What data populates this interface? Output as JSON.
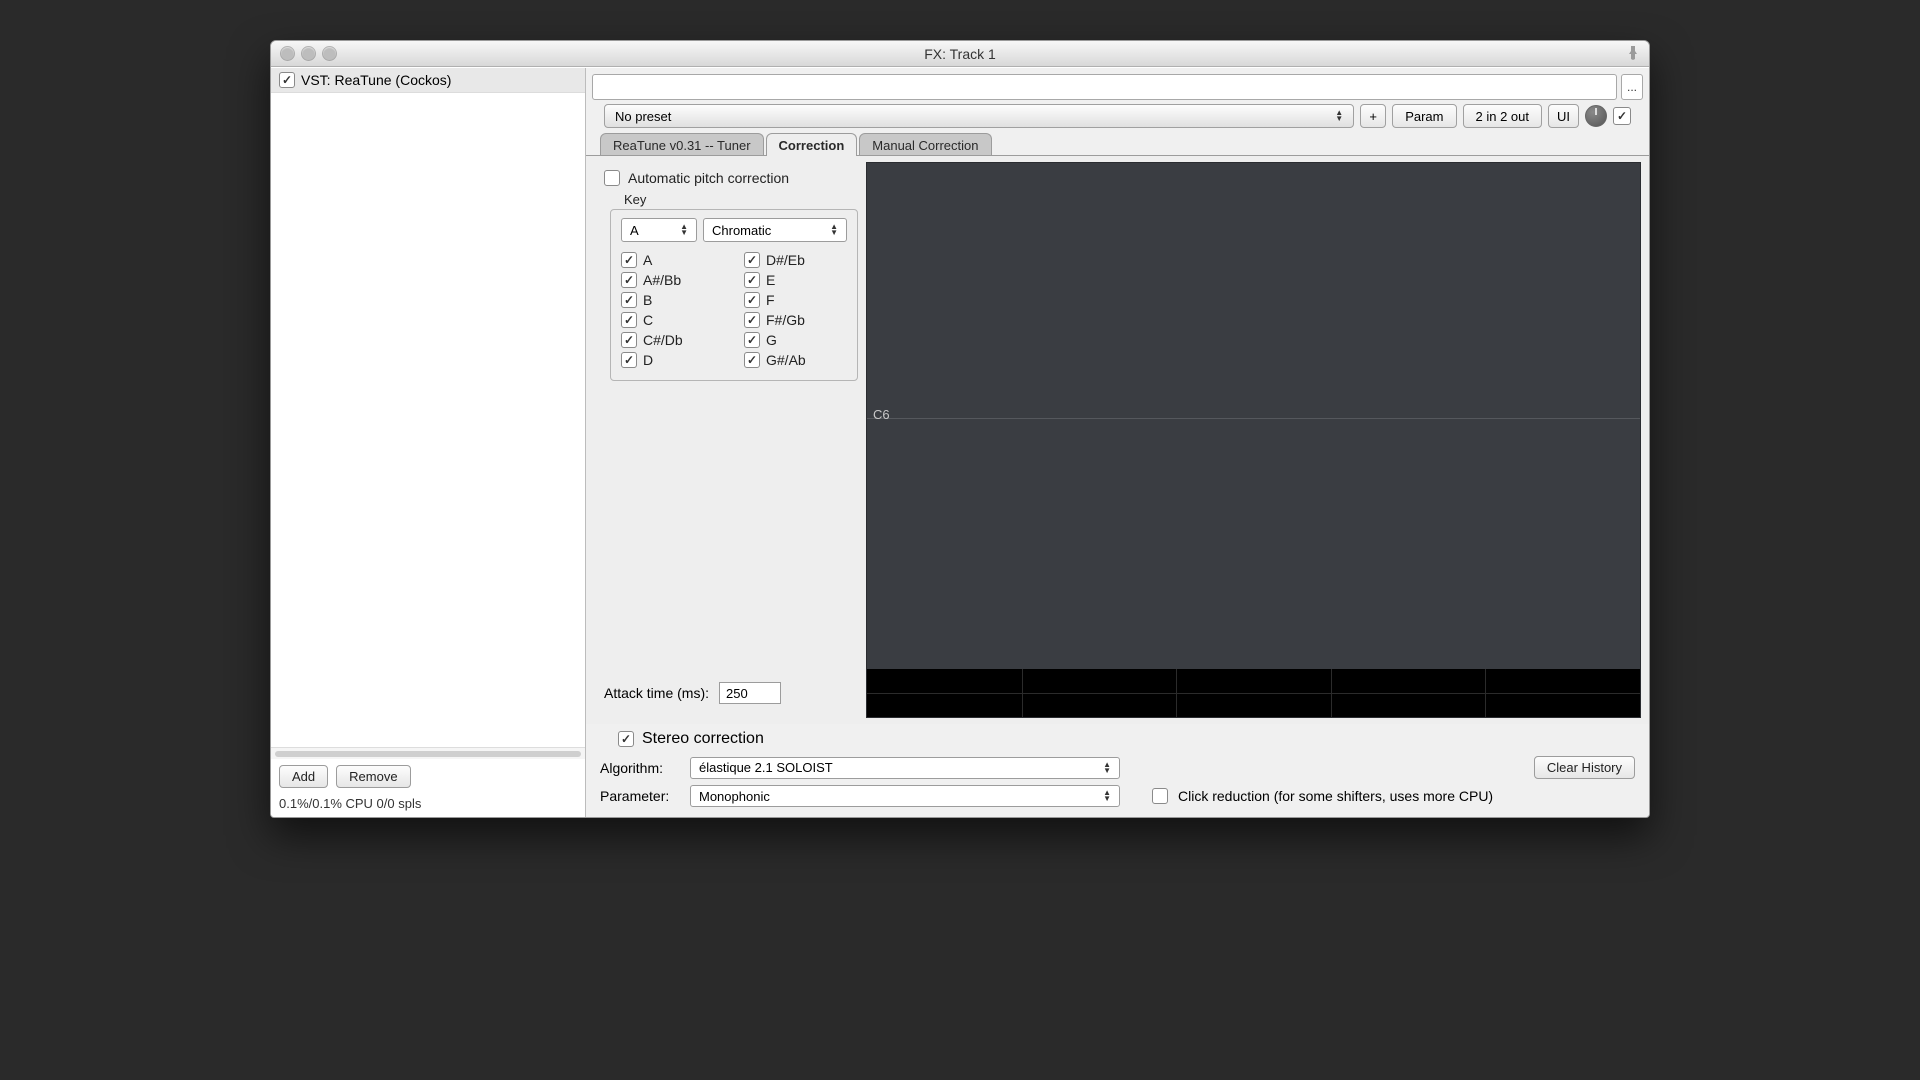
{
  "title": "FX: Track 1",
  "sidebar": {
    "item_checked": true,
    "item_label": "VST: ReaTune (Cockos)",
    "add_label": "Add",
    "remove_label": "Remove",
    "status": "0.1%/0.1% CPU 0/0 spls"
  },
  "top": {
    "dots": "...",
    "preset_label": "No preset",
    "plus": "+",
    "param": "Param",
    "io": "2 in 2 out",
    "ui": "UI"
  },
  "tabs": {
    "tuner": "ReaTune v0.31 -- Tuner",
    "correction": "Correction",
    "manual": "Manual Correction"
  },
  "correction": {
    "auto_label": "Automatic pitch correction",
    "auto_checked": false,
    "key_label": "Key",
    "root": "A",
    "scale": "Chromatic",
    "notes_col1": [
      "A",
      "A#/Bb",
      "B",
      "C",
      "C#/Db",
      "D"
    ],
    "notes_col2": [
      "D#/Eb",
      "E",
      "F",
      "F#/Gb",
      "G",
      "G#/Ab"
    ],
    "attack_label": "Attack time (ms):",
    "attack_value": "250",
    "stereo_label": "Stereo correction",
    "stereo_checked": true,
    "viewer_label": "C6"
  },
  "footer": {
    "algo_label": "Algorithm:",
    "algo_value": "élastique 2.1 SOLOIST",
    "param_label": "Parameter:",
    "param_value": "Monophonic",
    "clear_history": "Clear History",
    "click_reduction": "Click reduction (for some shifters, uses more CPU)",
    "click_checked": false
  }
}
